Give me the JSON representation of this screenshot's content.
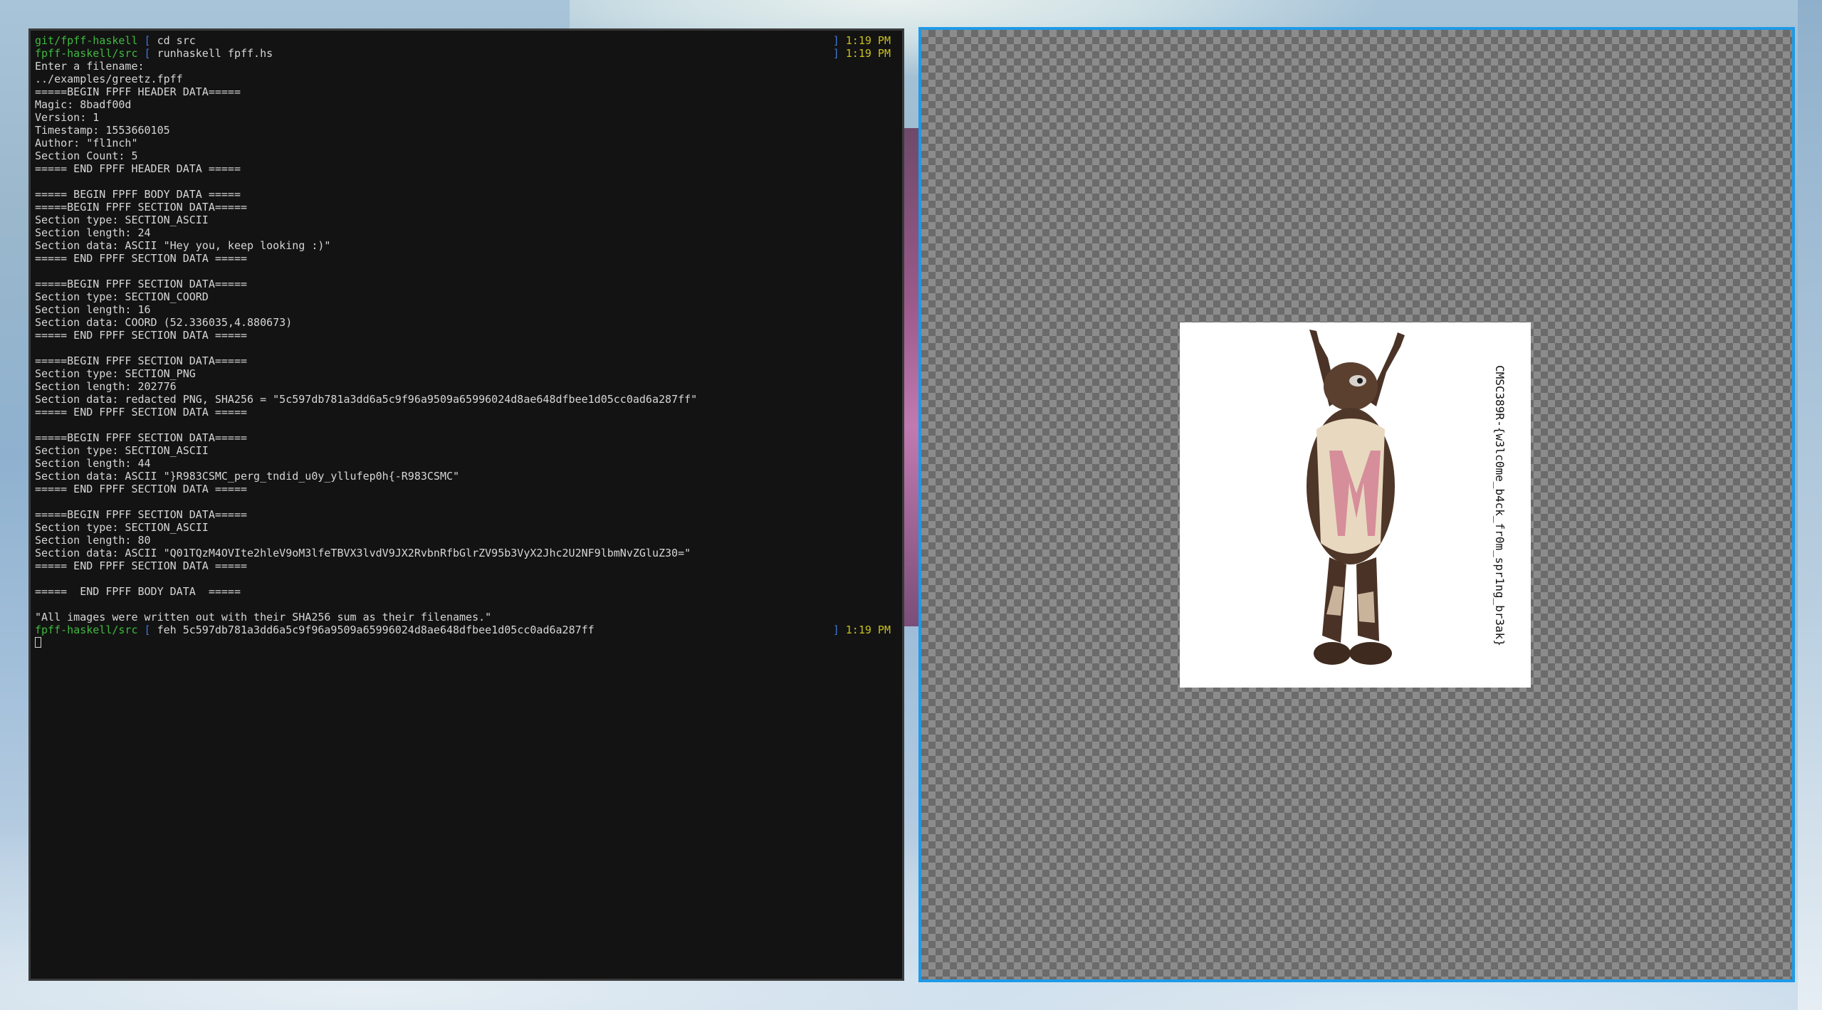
{
  "colors": {
    "terminal_bg": "#131313",
    "prompt_path": "#3fb93f",
    "prompt_bracket": "#3f78d6",
    "prompt_time": "#c8c020",
    "text": "#d6d6d6",
    "viewer_border_focus": "#1f9ae6"
  },
  "terminal": {
    "lines": [
      {
        "type": "prompt",
        "path": "git/fpff-haskell",
        "bracket": "[",
        "cmd": "cd src",
        "time_bracket": "]",
        "time": "1:19 PM"
      },
      {
        "type": "prompt",
        "path": "fpff-haskell/src",
        "bracket": "[",
        "cmd": "runhaskell fpff.hs",
        "time_bracket": "]",
        "time": "1:19 PM"
      },
      {
        "type": "out",
        "text": "Enter a filename:"
      },
      {
        "type": "out",
        "text": "../examples/greetz.fpff"
      },
      {
        "type": "out",
        "text": "=====BEGIN FPFF HEADER DATA====="
      },
      {
        "type": "out",
        "text": "Magic: 8badf00d"
      },
      {
        "type": "out",
        "text": "Version: 1"
      },
      {
        "type": "out",
        "text": "Timestamp: 1553660105"
      },
      {
        "type": "out",
        "text": "Author: \"fl1nch\""
      },
      {
        "type": "out",
        "text": "Section Count: 5"
      },
      {
        "type": "out",
        "text": "===== END FPFF HEADER DATA ====="
      },
      {
        "type": "out",
        "text": ""
      },
      {
        "type": "out",
        "text": "===== BEGIN FPFF BODY DATA ====="
      },
      {
        "type": "out",
        "text": "=====BEGIN FPFF SECTION DATA====="
      },
      {
        "type": "out",
        "text": "Section type: SECTION_ASCII"
      },
      {
        "type": "out",
        "text": "Section length: 24"
      },
      {
        "type": "out",
        "text": "Section data: ASCII \"Hey you, keep looking :)\""
      },
      {
        "type": "out",
        "text": "===== END FPFF SECTION DATA ====="
      },
      {
        "type": "out",
        "text": ""
      },
      {
        "type": "out",
        "text": "=====BEGIN FPFF SECTION DATA====="
      },
      {
        "type": "out",
        "text": "Section type: SECTION_COORD"
      },
      {
        "type": "out",
        "text": "Section length: 16"
      },
      {
        "type": "out",
        "text": "Section data: COORD (52.336035,4.880673)"
      },
      {
        "type": "out",
        "text": "===== END FPFF SECTION DATA ====="
      },
      {
        "type": "out",
        "text": ""
      },
      {
        "type": "out",
        "text": "=====BEGIN FPFF SECTION DATA====="
      },
      {
        "type": "out",
        "text": "Section type: SECTION_PNG"
      },
      {
        "type": "out",
        "text": "Section length: 202776"
      },
      {
        "type": "out",
        "text": "Section data: redacted PNG, SHA256 = \"5c597db781a3dd6a5c9f96a9509a65996024d8ae648dfbee1d05cc0ad6a287ff\""
      },
      {
        "type": "out",
        "text": "===== END FPFF SECTION DATA ====="
      },
      {
        "type": "out",
        "text": ""
      },
      {
        "type": "out",
        "text": "=====BEGIN FPFF SECTION DATA====="
      },
      {
        "type": "out",
        "text": "Section type: SECTION_ASCII"
      },
      {
        "type": "out",
        "text": "Section length: 44"
      },
      {
        "type": "out",
        "text": "Section data: ASCII \"}R983CSMC_perg_tndid_u0y_yllufep0h{-R983CSMC\""
      },
      {
        "type": "out",
        "text": "===== END FPFF SECTION DATA ====="
      },
      {
        "type": "out",
        "text": ""
      },
      {
        "type": "out",
        "text": "=====BEGIN FPFF SECTION DATA====="
      },
      {
        "type": "out",
        "text": "Section type: SECTION_ASCII"
      },
      {
        "type": "out",
        "text": "Section length: 80"
      },
      {
        "type": "out",
        "text": "Section data: ASCII \"Q01TQzM4OVIte2hleV9oM3lfeTBVX3lvdV9JX2RvbnRfbGlrZV95b3VyX2Jhc2U2NF9lbmNvZGluZ30=\""
      },
      {
        "type": "out",
        "text": "===== END FPFF SECTION DATA ====="
      },
      {
        "type": "out",
        "text": ""
      },
      {
        "type": "out",
        "text": "=====  END FPFF BODY DATA  ====="
      },
      {
        "type": "out",
        "text": ""
      },
      {
        "type": "out",
        "text": "\"All images were written out with their SHA256 sum as their filenames.\""
      },
      {
        "type": "prompt",
        "path": "fpff-haskell/src",
        "bracket": "[",
        "cmd": "feh 5c597db781a3dd6a5c9f96a9509a65996024d8ae648dfbee1d05cc0ad6a287ff",
        "time_bracket": "]",
        "time": "1:19 PM"
      },
      {
        "type": "cursor"
      }
    ]
  },
  "viewer": {
    "image_text": "CMSC389R-{w3lc0me_b4ck_fr0m_spr1ng_br3ak}"
  }
}
